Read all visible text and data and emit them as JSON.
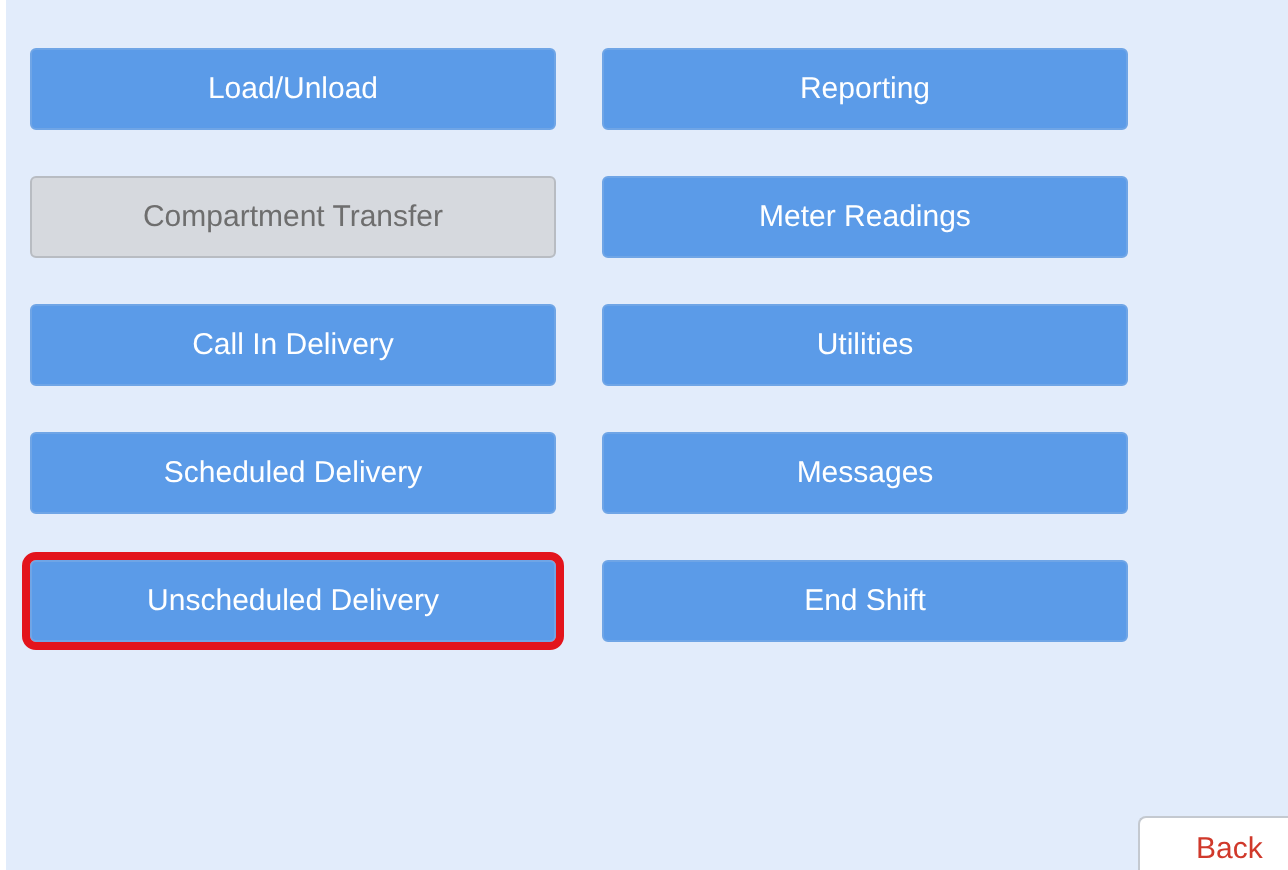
{
  "menu_buttons": [
    {
      "label": "Load/Unload",
      "disabled": false,
      "selected": false
    },
    {
      "label": "Reporting",
      "disabled": false,
      "selected": false
    },
    {
      "label": "Compartment Transfer",
      "disabled": true,
      "selected": false
    },
    {
      "label": "Meter Readings",
      "disabled": false,
      "selected": false
    },
    {
      "label": "Call In Delivery",
      "disabled": false,
      "selected": false
    },
    {
      "label": "Utilities",
      "disabled": false,
      "selected": false
    },
    {
      "label": "Scheduled Delivery",
      "disabled": false,
      "selected": false
    },
    {
      "label": "Messages",
      "disabled": false,
      "selected": false
    },
    {
      "label": "Unscheduled Delivery",
      "disabled": false,
      "selected": true
    },
    {
      "label": "End Shift",
      "disabled": false,
      "selected": false
    }
  ],
  "back_button": {
    "label": "Back"
  }
}
